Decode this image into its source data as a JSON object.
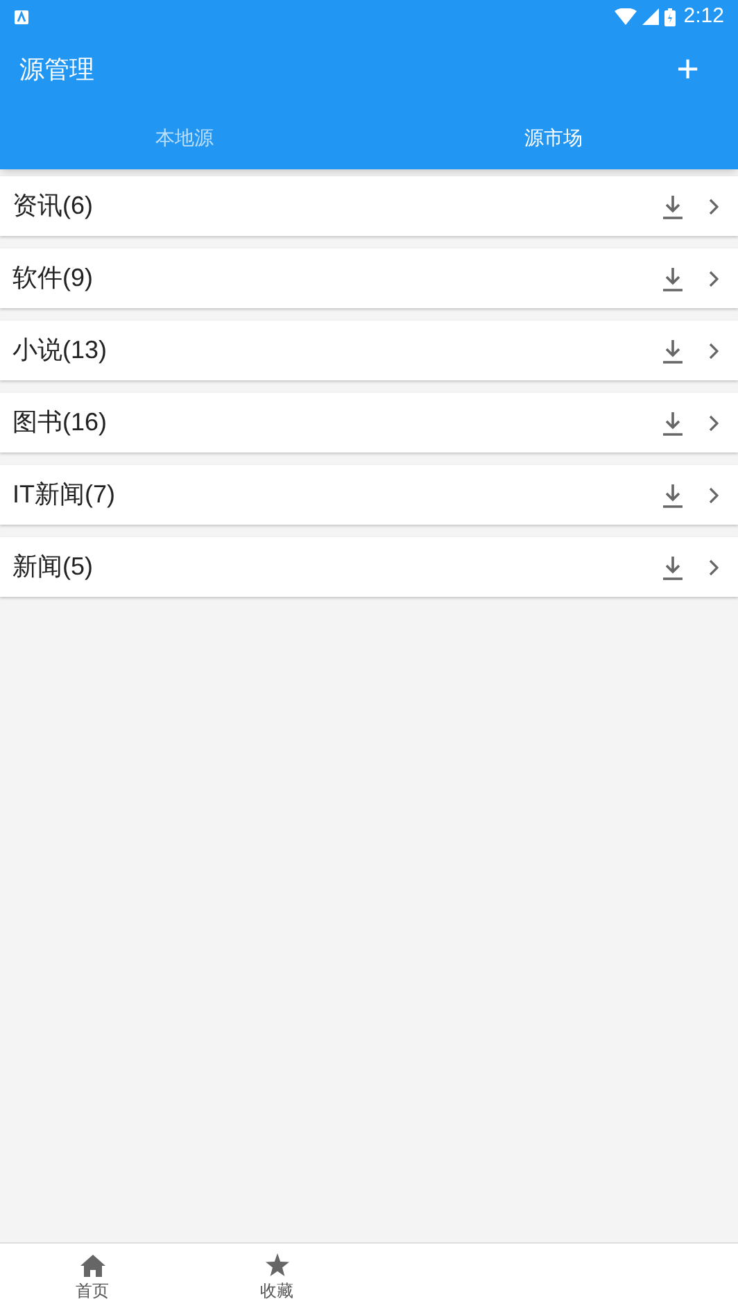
{
  "status_bar": {
    "time": "2:12"
  },
  "toolbar": {
    "title": "源管理",
    "action": "+"
  },
  "tabs": [
    {
      "label": "本地源",
      "selected": false
    },
    {
      "label": "源市场",
      "selected": true
    }
  ],
  "categories": [
    {
      "label": "资讯(6)"
    },
    {
      "label": "软件(9)"
    },
    {
      "label": "小说(13)"
    },
    {
      "label": "图书(16)"
    },
    {
      "label": "IT新闻(7)"
    },
    {
      "label": "新闻(5)"
    }
  ],
  "bottom_nav": [
    {
      "label": "首页",
      "kind": "home"
    },
    {
      "label": "收藏",
      "kind": "star"
    }
  ]
}
